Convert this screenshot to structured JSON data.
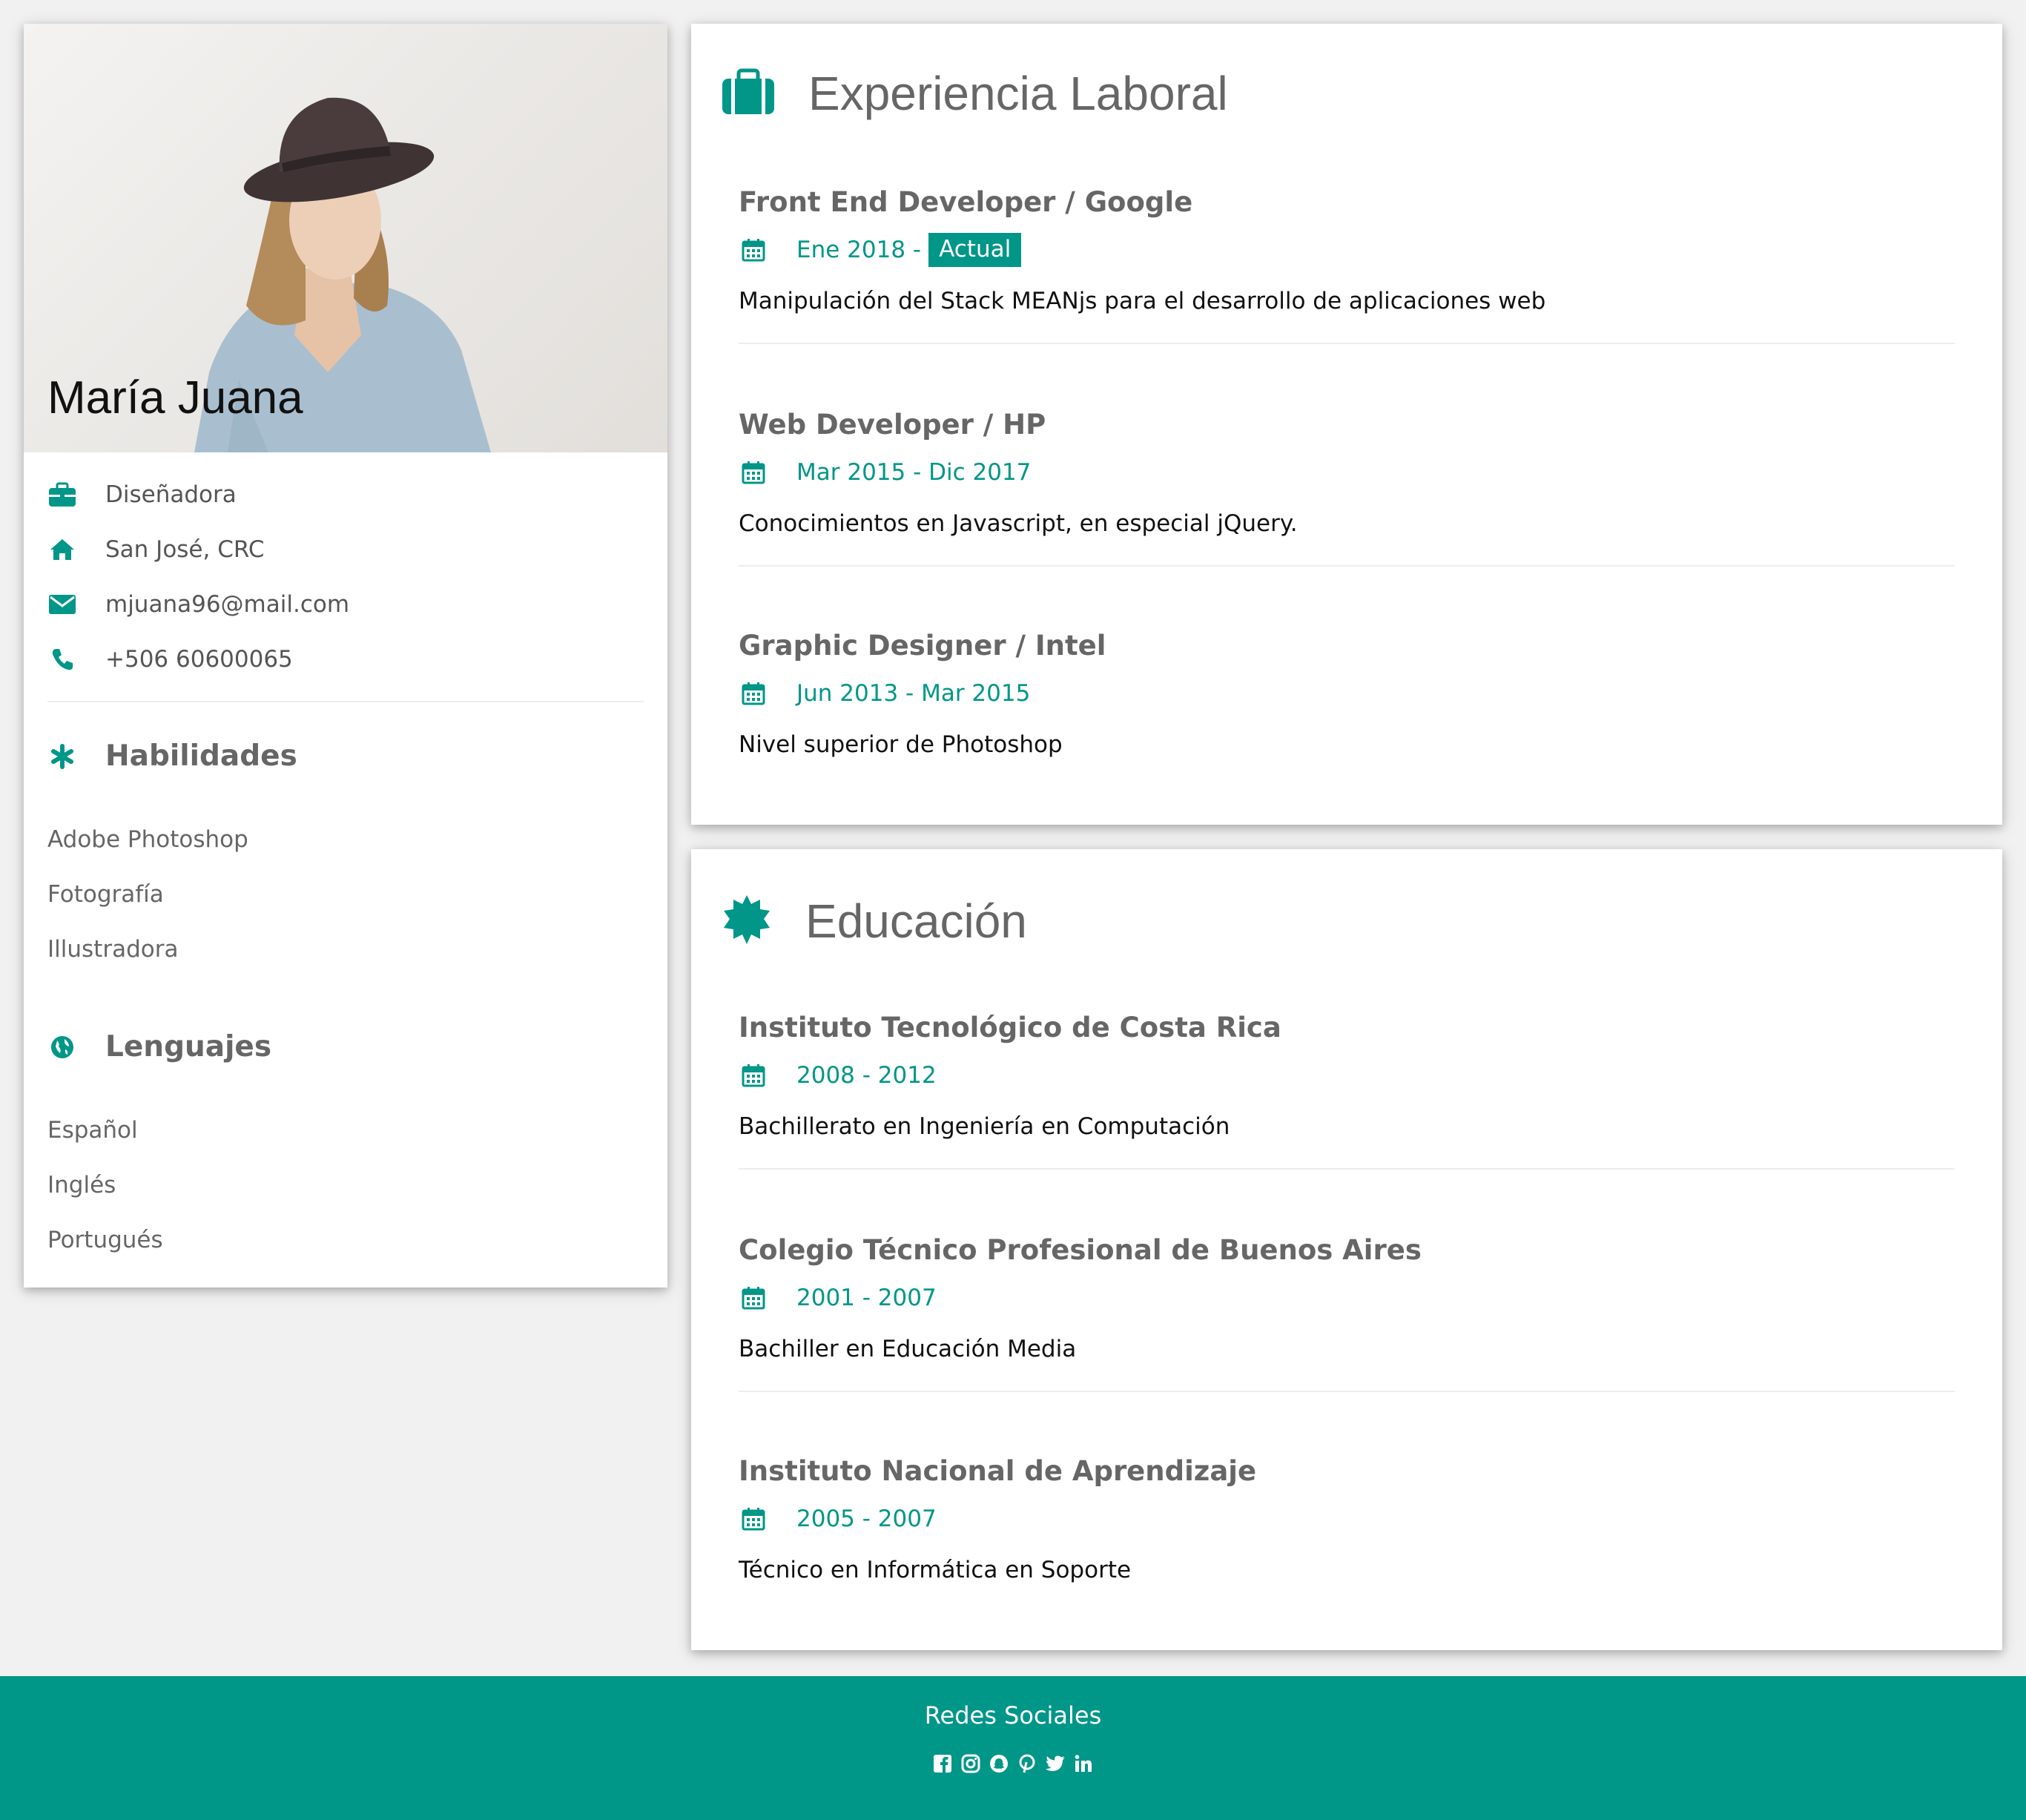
{
  "profile": {
    "name": "María Juana",
    "job": "Diseñadora",
    "location": "San José, CRC",
    "email": "mjuana96@mail.com",
    "phone": "+506 60600065"
  },
  "skills": {
    "title": "Habilidades",
    "items": [
      "Adobe Photoshop",
      "Fotografía",
      "Illustradora"
    ]
  },
  "languages": {
    "title": "Lenguajes",
    "items": [
      "Español",
      "Inglés",
      "Portugués"
    ]
  },
  "experience": {
    "title": "Experiencia Laboral",
    "entries": [
      {
        "title": "Front End Developer / Google",
        "date": "Ene 2018 -",
        "tag": "Actual",
        "description": "Manipulación del Stack MEANjs para el desarrollo de aplicaciones web"
      },
      {
        "title": "Web Developer / HP",
        "date": "Mar 2015 - Dic 2017",
        "description": "Conocimientos en Javascript, en especial jQuery."
      },
      {
        "title": "Graphic Designer / Intel",
        "date": "Jun 2013 - Mar 2015",
        "description": "Nivel superior de Photoshop"
      }
    ]
  },
  "education": {
    "title": "Educación",
    "entries": [
      {
        "title": "Instituto Tecnológico de Costa Rica",
        "date": "2008 - 2012",
        "description": "Bachillerato en Ingeniería en Computación"
      },
      {
        "title": "Colegio Técnico Profesional de Buenos Aires",
        "date": "2001 - 2007",
        "description": "Bachiller en Educación Media"
      },
      {
        "title": "Instituto Nacional de Aprendizaje",
        "date": "2005 - 2007",
        "description": "Técnico en Informática en Soporte"
      }
    ]
  },
  "footer": {
    "title": "Redes Sociales",
    "socials": [
      "facebook-icon",
      "instagram-icon",
      "snapchat-icon",
      "pinterest-icon",
      "twitter-icon",
      "linkedin-icon"
    ]
  },
  "colors": {
    "accent": "#009688",
    "background": "#f1f1f1",
    "card": "#ffffff"
  }
}
